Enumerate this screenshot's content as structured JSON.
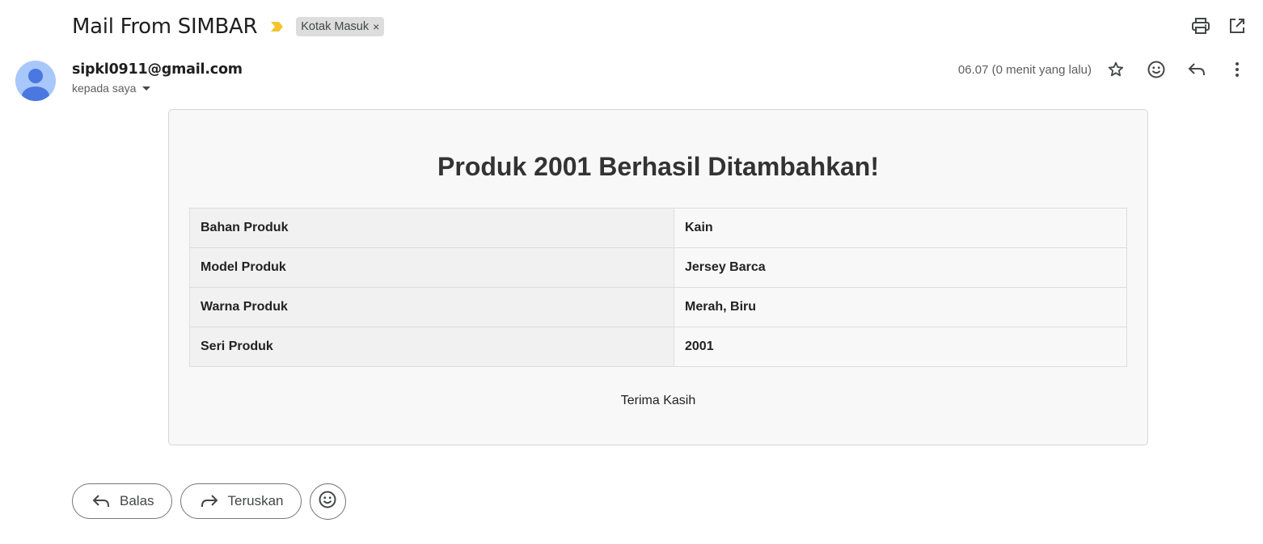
{
  "email": {
    "subject": "Mail From SIMBAR",
    "label": "Kotak Masuk",
    "label_remove": "×",
    "sender": "sipkl0911@gmail.com",
    "recipient": "kepada saya",
    "timestamp": "06.07 (0 menit yang lalu)"
  },
  "icons": {
    "importance": "importance-marker-icon",
    "print": "print-icon",
    "open_new_window": "open-in-new-window-icon",
    "star": "star-icon",
    "emoji": "emoji-icon",
    "reply": "reply-icon",
    "more": "more-vert-icon"
  },
  "colors": {
    "importance": "#f4c430",
    "avatar_bg": "#a8c7fa",
    "avatar_fg": "#4a78e0",
    "card_bg": "#f8f8f8",
    "table_key_bg": "#f1f1f1"
  },
  "body": {
    "title": "Produk 2001 Berhasil Ditambahkan!",
    "rows": [
      {
        "key": "Bahan Produk",
        "value": "Kain"
      },
      {
        "key": "Model Produk",
        "value": "Jersey Barca"
      },
      {
        "key": "Warna Produk",
        "value": "Merah, Biru"
      },
      {
        "key": "Seri Produk",
        "value": "2001"
      }
    ],
    "closing": "Terima Kasih"
  },
  "actions": {
    "reply_label": "Balas",
    "forward_label": "Teruskan"
  }
}
